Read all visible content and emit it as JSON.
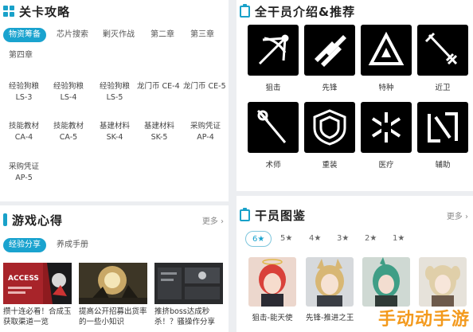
{
  "levels": {
    "title": "关卡攻略",
    "tabs": [
      "物资筹备",
      "芯片搜索",
      "剿灭作战",
      "第二章",
      "第三章",
      "第四章"
    ],
    "rows": [
      [
        [
          "经验狗粮",
          "LS-3"
        ],
        [
          "经验狗粮",
          "LS-4"
        ],
        [
          "经验狗粮",
          "LS-5"
        ],
        [
          "龙门币",
          "CE-4"
        ],
        [
          "龙门币",
          "CE-5"
        ]
      ],
      [
        [
          "技能教材",
          "CA-4"
        ],
        [
          "技能教材",
          "CA-5"
        ],
        [
          "基建材料",
          "SK-4"
        ],
        [
          "基建材料",
          "SK-5"
        ],
        [
          "采购凭证",
          "AP-4"
        ]
      ],
      [
        [
          "采购凭证",
          "AP-5"
        ]
      ]
    ]
  },
  "tips": {
    "title": "游戏心得",
    "more": "更多",
    "tabs": [
      "经验分享",
      "养成手册"
    ],
    "articles": [
      {
        "text": "攒十连必看！合成玉获取渠道一览",
        "image_text": "ACCESS"
      },
      {
        "text": "提高公开招募出货率的一些小知识",
        "image_text": ""
      },
      {
        "text": "推挤boss达成秒杀！？骚操作分享",
        "image_text": ""
      }
    ]
  },
  "classes": {
    "title": "全干员介绍&推荐",
    "items": [
      {
        "label": "狙击",
        "icon": "sniper-icon"
      },
      {
        "label": "先锋",
        "icon": "vanguard-icon"
      },
      {
        "label": "特种",
        "icon": "specialist-icon"
      },
      {
        "label": "近卫",
        "icon": "guard-icon"
      },
      {
        "label": "术师",
        "icon": "caster-icon"
      },
      {
        "label": "重装",
        "icon": "defender-icon"
      },
      {
        "label": "医疗",
        "icon": "medic-icon"
      },
      {
        "label": "辅助",
        "icon": "supporter-icon"
      }
    ]
  },
  "gallery": {
    "title": "干员图鉴",
    "more": "更多",
    "rarity_tabs": [
      "6★",
      "5★",
      "4★",
      "3★",
      "2★",
      "1★"
    ],
    "operators": [
      {
        "label": "狙击-能天使",
        "hair": "#d9413a",
        "bg": "#e8d3c9"
      },
      {
        "label": "先锋-推进之王",
        "hair": "#d8b774",
        "bg": "#d6d9dc"
      },
      {
        "label": "",
        "hair": "#3f9e86",
        "bg": "#cfd9d3"
      },
      {
        "label": "",
        "hair": "#e0cfa9",
        "bg": "#e6e2da"
      }
    ]
  },
  "colors": {
    "accent": "#1aa3cf",
    "watermark": "#f39a1e"
  },
  "watermark": "手动动手游"
}
